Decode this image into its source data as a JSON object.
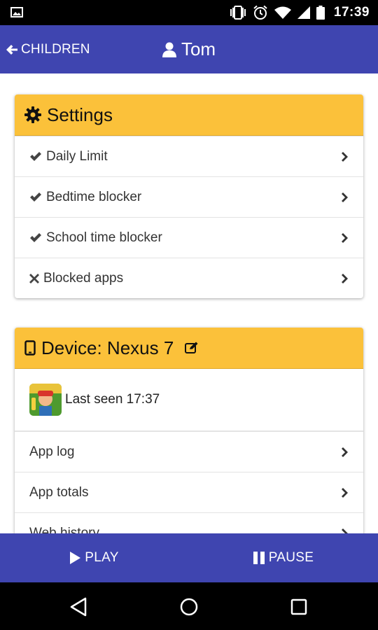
{
  "status_bar": {
    "time": "17:39",
    "icons": [
      "image-icon",
      "vibrate-icon",
      "alarm-icon",
      "wifi-icon",
      "signal-icon",
      "battery-icon"
    ]
  },
  "app_bar": {
    "back_label": "CHILDREN",
    "title": "Tom",
    "color": "#3f45b0"
  },
  "settings_card": {
    "title": "Settings",
    "header_color": "#fbc13a",
    "items": [
      {
        "label": "Daily Limit",
        "state": "check"
      },
      {
        "label": "Bedtime blocker",
        "state": "check"
      },
      {
        "label": "School time blocker",
        "state": "check"
      },
      {
        "label": "Blocked apps",
        "state": "cross"
      }
    ]
  },
  "device_card": {
    "title": "Device: Nexus 7",
    "last_seen": "Last seen 17:37",
    "items": [
      {
        "label": "App log"
      },
      {
        "label": "App totals"
      },
      {
        "label": "Web history"
      }
    ]
  },
  "bottom_bar": {
    "play_label": "PLAY",
    "pause_label": "PAUSE"
  }
}
